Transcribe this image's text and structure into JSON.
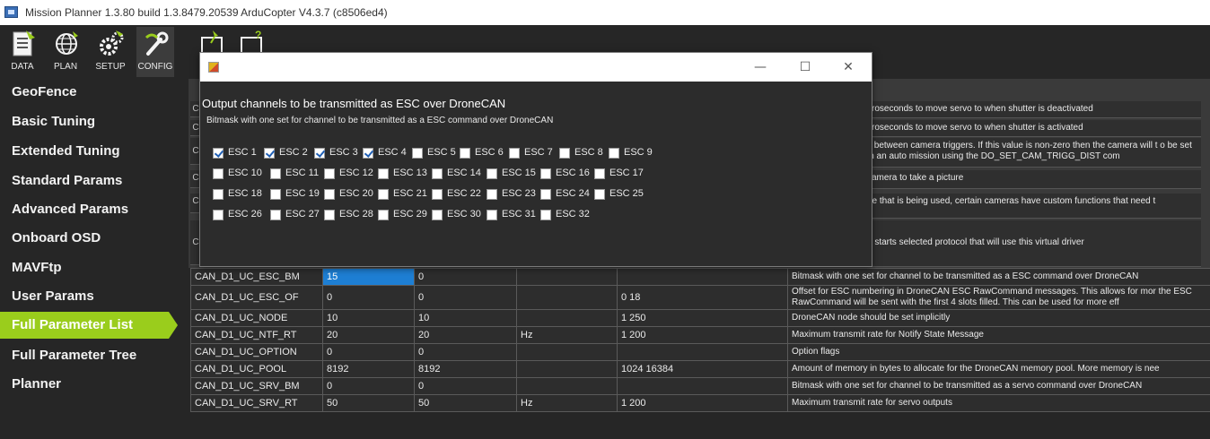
{
  "window": {
    "title": "Mission Planner 1.3.80 build 1.3.8479.20539 ArduCopter V4.3.7 (c8506ed4)"
  },
  "toolbar": {
    "buttons": [
      {
        "label": "DATA",
        "icon": "data-icon"
      },
      {
        "label": "PLAN",
        "icon": "globe-icon"
      },
      {
        "label": "SETUP",
        "icon": "gears-icon"
      },
      {
        "label": "CONFIG",
        "icon": "wrench-icon",
        "active": true
      },
      {
        "label": "",
        "icon": "simulation-icon"
      },
      {
        "label": "",
        "icon": "help-icon"
      }
    ]
  },
  "sidebar": {
    "items": [
      {
        "label": "GeoFence"
      },
      {
        "label": "Basic Tuning"
      },
      {
        "label": "Extended Tuning"
      },
      {
        "label": "Standard Params"
      },
      {
        "label": "Advanced Params"
      },
      {
        "label": "Onboard OSD"
      },
      {
        "label": "MAVFtp"
      },
      {
        "label": "User Params"
      },
      {
        "label": "Full Parameter List",
        "active": true
      },
      {
        "label": "Full Parameter Tree"
      },
      {
        "label": "Planner"
      }
    ]
  },
  "behind_rows": [
    {
      "prefix": "C",
      "desc": "croseconds to move servo to when shutter is deactivated"
    },
    {
      "prefix": "C",
      "desc": "croseconds to move servo to when shutter is activated"
    },
    {
      "prefix": "C",
      "desc": "s between camera triggers. If this value is non-zero then the camera will t o be set in an auto mission using the DO_SET_CAM_TRIGG_DIST com"
    },
    {
      "prefix": "C",
      "desc": "camera to take a picture"
    },
    {
      "prefix": "C",
      "desc": "pe that is being used, certain cameras have custom functions that need t"
    },
    {
      "prefix": "C",
      "desc": "n starts selected protocol that will use this virtual driver"
    }
  ],
  "params": {
    "rows": [
      {
        "name": "CAN_D1_UC_ESC_BM",
        "value": "15",
        "default": "0",
        "units": "",
        "range": "",
        "desc": "Bitmask with one set for channel to be transmitted as a ESC command over DroneCAN",
        "selected": true
      },
      {
        "name": "CAN_D1_UC_ESC_OF",
        "value": "0",
        "default": "0",
        "units": "",
        "range": "0 18",
        "desc": "Offset for ESC numbering in DroneCAN ESC RawCommand messages. This allows for mor the ESC RawCommand will be sent with the first 4 slots filled. This can be used for more eff",
        "tall": true
      },
      {
        "name": "CAN_D1_UC_NODE",
        "value": "10",
        "default": "10",
        "units": "",
        "range": "1 250",
        "desc": "DroneCAN node should be set implicitly"
      },
      {
        "name": "CAN_D1_UC_NTF_RT",
        "value": "20",
        "default": "20",
        "units": "Hz",
        "range": "1 200",
        "desc": "Maximum transmit rate for Notify State Message"
      },
      {
        "name": "CAN_D1_UC_OPTION",
        "value": "0",
        "default": "0",
        "units": "",
        "range": "",
        "desc": "Option flags"
      },
      {
        "name": "CAN_D1_UC_POOL",
        "value": "8192",
        "default": "8192",
        "units": "",
        "range": "1024 16384",
        "desc": "Amount of memory in bytes to allocate for the DroneCAN memory pool. More memory is nee"
      },
      {
        "name": "CAN_D1_UC_SRV_BM",
        "value": "0",
        "default": "0",
        "units": "",
        "range": "",
        "desc": "Bitmask with one set for channel to be transmitted as a servo command over DroneCAN"
      },
      {
        "name": "CAN_D1_UC_SRV_RT",
        "value": "50",
        "default": "50",
        "units": "Hz",
        "range": "1 200",
        "desc": "Maximum transmit rate for servo outputs"
      }
    ]
  },
  "dialog": {
    "heading": "Output channels to be transmitted as ESC over DroneCAN",
    "subtitle": "Bitmask with one set for channel to be transmitted as a ESC command over DroneCAN",
    "controls": {
      "minimize": "—",
      "maximize": "☐",
      "close": "✕"
    },
    "checkboxes": [
      {
        "label": "ESC 1",
        "checked": true
      },
      {
        "label": "ESC 2",
        "checked": true
      },
      {
        "label": "ESC 3",
        "checked": true
      },
      {
        "label": "ESC 4",
        "checked": true
      },
      {
        "label": "ESC 5",
        "checked": false
      },
      {
        "label": "ESC 6",
        "checked": false
      },
      {
        "label": "ESC 7",
        "checked": false
      },
      {
        "label": "ESC 8",
        "checked": false
      },
      {
        "label": "ESC 9",
        "checked": false
      },
      {
        "label": "ESC 10",
        "checked": false
      },
      {
        "label": "ESC 11",
        "checked": false
      },
      {
        "label": "ESC 12",
        "checked": false
      },
      {
        "label": "ESC 13",
        "checked": false
      },
      {
        "label": "ESC 14",
        "checked": false
      },
      {
        "label": "ESC 15",
        "checked": false
      },
      {
        "label": "ESC 16",
        "checked": false
      },
      {
        "label": "ESC 17",
        "checked": false
      },
      {
        "label": "ESC 18",
        "checked": false
      },
      {
        "label": "ESC 19",
        "checked": false
      },
      {
        "label": "ESC 20",
        "checked": false
      },
      {
        "label": "ESC 21",
        "checked": false
      },
      {
        "label": "ESC 22",
        "checked": false
      },
      {
        "label": "ESC 23",
        "checked": false
      },
      {
        "label": "ESC 24",
        "checked": false
      },
      {
        "label": "ESC 25",
        "checked": false
      },
      {
        "label": "ESC 26",
        "checked": false
      },
      {
        "label": "ESC 27",
        "checked": false
      },
      {
        "label": "ESC 28",
        "checked": false
      },
      {
        "label": "ESC 29",
        "checked": false
      },
      {
        "label": "ESC 30",
        "checked": false
      },
      {
        "label": "ESC 31",
        "checked": false
      },
      {
        "label": "ESC 32",
        "checked": false
      }
    ]
  },
  "colors": {
    "sidebar_bg": "#262626",
    "active_item": "#9acd1c",
    "selected_cell": "#1e7fd4"
  }
}
